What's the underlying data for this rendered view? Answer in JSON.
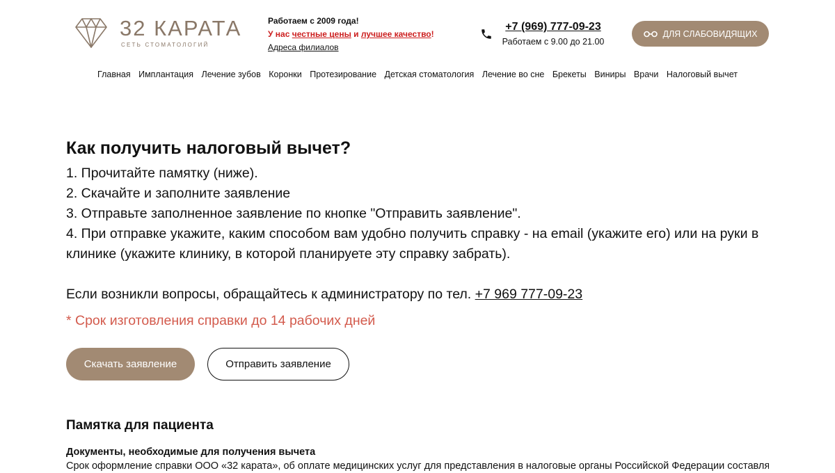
{
  "header": {
    "logo": {
      "title": "32 КАРАТА",
      "subtitle": "СЕТЬ СТОМАТОЛОГИЙ",
      "icon": "diamond-icon",
      "color": "#8a7868"
    },
    "info": {
      "since": "Работаем с 2009 года!",
      "quality_prefix": "У нас ",
      "quality_link1": "честные цены",
      "quality_and": " и ",
      "quality_link2": "лучшее качество",
      "quality_suffix": "!",
      "addresses_icon": "",
      "addresses_link": "Адреса филиалов"
    },
    "phone": {
      "icon": "phone-icon",
      "number": "+7 (969) 777-09-23",
      "hours": "Работаем с 9.00 до 21.00"
    },
    "accessibility": {
      "icon": "glasses-icon",
      "label": "ДЛЯ СЛАБОВИДЯЩИХ",
      "color": "#a28a73"
    }
  },
  "nav": {
    "items": [
      "Главная",
      "Имплантация",
      "Лечение зубов",
      "Коронки",
      "Протезирование",
      "Детская стоматология",
      "Лечение во сне",
      "Брекеты",
      "Виниры",
      "Врачи",
      "Налоговый вычет"
    ]
  },
  "main": {
    "heading": "Как получить налоговый вычет?",
    "steps": [
      "1. Прочитайте памятку (ниже).",
      "2. Скачайте и заполните заявление",
      "3. Отправьте заполненное заявление по кнопке \"Отправить заявление\".",
      "4. При отправке укажите, каким способом вам удобно получить справку - на email (укажите его) или на руки в клинике (укажите клинику, в которой планируете эту справку забрать)."
    ],
    "contact_text": "Если возникли вопросы, обращайтесь к администратору по тел. ",
    "contact_phone": "+7 969 777-09-23",
    "note": "* Срок изготовления справки до 14 рабочих дней",
    "note_color": "#d35b4d",
    "buttons": {
      "download": "Скачать заявление",
      "send": "Отправить заявление"
    }
  },
  "memo": {
    "title": "Памятка для пациента",
    "subtitle": "Документы, необходимые для получения вычета",
    "text": "Срок оформление справки ООО «32 карата», об оплате медицинских услуг для представления в налоговые органы Российской Федерации составляет"
  }
}
